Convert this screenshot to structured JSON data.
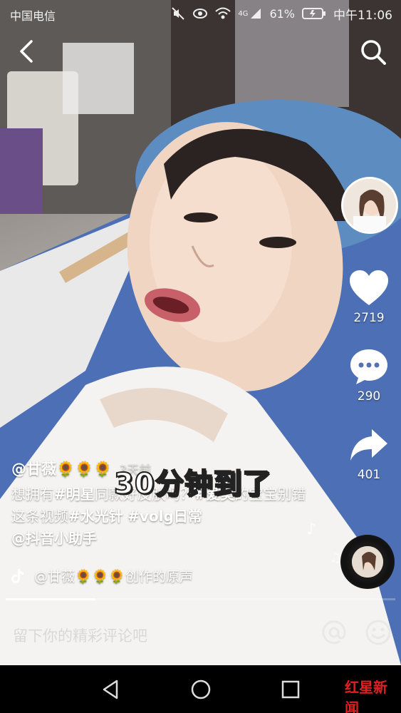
{
  "status_bar": {
    "carrier": "中国电信",
    "network": "4G",
    "battery": "61%",
    "clock": "中午11:06"
  },
  "video": {
    "author": "@甘薇🌻🌻🌻",
    "posted": "3天前",
    "sticker_text": "30分钟到了",
    "description": {
      "p1": "想拥有",
      "tag1": "#明星",
      "p2": "同款好皮肤吗？",
      "tag2": "#爱美",
      "p3": "的宝宝别错这条视频",
      "tag3": "#水光针",
      "tag4": "#volg日常",
      "mention": "@抖音小助手"
    },
    "music": "@甘薇🌻🌻🌻创作的原声",
    "progress": 0.23
  },
  "rail": {
    "likes": "2719",
    "comments": "290",
    "shares": "401"
  },
  "comment_bar": {
    "placeholder": "留下你的精彩评论吧"
  },
  "watermark": {
    "brand": "红星新闻"
  },
  "icons": {
    "back": "chevron-left-icon",
    "search": "search-icon",
    "like": "heart-icon",
    "comment": "speech-bubble-icon",
    "share": "share-arrow-icon",
    "music": "tiktok-note-icon",
    "at": "at-sign-icon",
    "emoji": "smiley-icon"
  }
}
